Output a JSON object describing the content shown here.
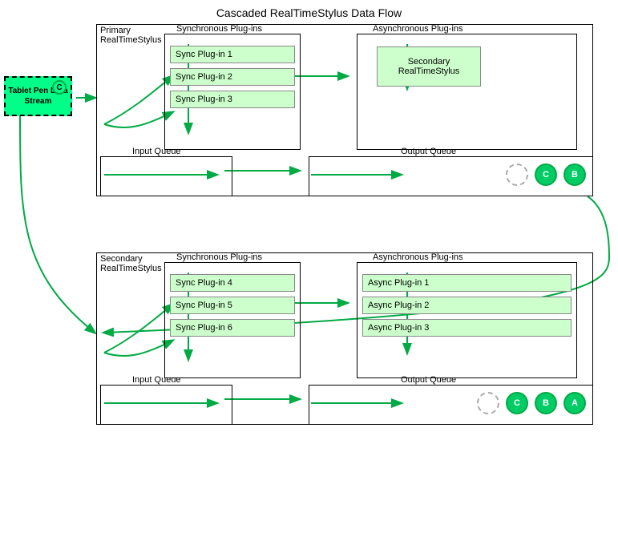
{
  "title": "Cascaded RealTimeStylus Data Flow",
  "tablet_pen": {
    "label": "Tablet Pen Data Stream",
    "badge": "C"
  },
  "top_section": {
    "primary_rts_label": "Primary\nRealTimeStylus",
    "sync_plugins_label": "Synchronous Plug-ins",
    "async_plugins_label": "Asynchronous Plug-ins",
    "input_queue_label": "Input Queue",
    "output_queue_label": "Output Queue",
    "sync_plugins": [
      "Sync Plug-in 1",
      "Sync Plug-in 2",
      "Sync Plug-in 3"
    ],
    "secondary_rts_inner": "Secondary\nRealTimeStylus",
    "output_circles": [
      "",
      "C",
      "B"
    ]
  },
  "bottom_section": {
    "secondary_rts_label": "Secondary\nRealTimeStylus",
    "sync_plugins_label": "Synchronous Plug-ins",
    "async_plugins_label": "Asynchronous Plug-ins",
    "input_queue_label": "Input Queue",
    "output_queue_label": "Output Queue",
    "sync_plugins": [
      "Sync Plug-in 4",
      "Sync Plug-in 5",
      "Sync Plug-in 6"
    ],
    "async_plugins": [
      "Async Plug-in 1",
      "Async Plug-in 2",
      "Async Plug-in 3"
    ],
    "output_circles": [
      "",
      "C",
      "B",
      "A"
    ]
  }
}
